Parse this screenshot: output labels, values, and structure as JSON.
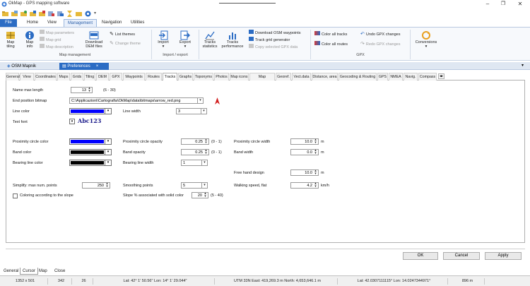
{
  "app": {
    "title": "OkMap - GPS mapping software"
  },
  "ribbon_tabs": [
    "File",
    "Home",
    "View",
    "Management",
    "Navigation",
    "Utilities"
  ],
  "ribbon": {
    "map_tiling": "Map tiling",
    "map_info": "Map info",
    "map_parameters": "Map parameters",
    "map_grid": "Map grid",
    "map_description": "Map description",
    "download_dem": "Download DEM files",
    "list_themes": "List themes",
    "change_theme": "Change theme",
    "map_management": "Map management",
    "import": "Import",
    "export": "Export",
    "import_export": "Import / export",
    "tracks_statistics": "Tracks statistics",
    "tracks_performance": "Tracks performance",
    "download_osm": "Download OSM waypoints",
    "track_grid": "Track grid generator",
    "copy_gpx": "Copy selected GPX data",
    "color_all_tracks": "Color all tracks",
    "color_all_routes": "Color all routes",
    "undo_gpx": "Undo GPX changes",
    "redo_gpx": "Redo GPX changes",
    "gpx": "GPX",
    "conversions": "Conversions"
  },
  "doc_tabs": {
    "map": "OSM Mapnik",
    "prefs": "Preferences",
    "close": "×"
  },
  "sub_tabs": [
    "General",
    "View",
    "Coordinates",
    "Maps",
    "Grids",
    "Tiling",
    "DEM",
    "GPX",
    "Waypoints",
    "Routes",
    "Tracks",
    "Graphs",
    "Toponyms",
    "Photos",
    "Map icons",
    "Map comments",
    "Georef.",
    "Vect.data",
    "Distance, area",
    "Geocoding & Routing",
    "GPS",
    "NMEA",
    "Navig.",
    "Compass"
  ],
  "form": {
    "name_max_length": {
      "label": "Name max length",
      "value": "13",
      "hint": "(6 - 30)"
    },
    "end_position_bitmap": {
      "label": "End position bitmap",
      "value": "C:\\Applicazioni\\Cartografia\\OkMap\\data\\bitmaps\\arrow_red.png"
    },
    "line_color": {
      "label": "Line color"
    },
    "line_width": {
      "label": "Line width",
      "value": "3"
    },
    "text_font": {
      "label": "Text font",
      "sample": "Abc123"
    },
    "proximity_circle_color": {
      "label": "Proximity circle color"
    },
    "proximity_circle_opacity": {
      "label": "Proximity circle opacity",
      "value": "0.25",
      "hint": "(0 - 1)"
    },
    "proximity_circle_width": {
      "label": "Proximity circle width",
      "value": "10.0",
      "unit": "m"
    },
    "band_color": {
      "label": "Band color"
    },
    "band_opacity": {
      "label": "Band opacity",
      "value": "0.25",
      "hint": "(0 - 1)"
    },
    "band_width": {
      "label": "Band width",
      "value": "0.0",
      "unit": "m"
    },
    "bearing_line_color": {
      "label": "Bearing line color"
    },
    "bearing_line_width": {
      "label": "Bearing line width",
      "value": "1"
    },
    "free_hand_design": {
      "label": "Free hand design",
      "value": "10.0",
      "unit": "m"
    },
    "simplify": {
      "label": "Simplify: max num. points",
      "value": "250"
    },
    "smoothing_points": {
      "label": "Smoothing points",
      "value": "5"
    },
    "walking_speed": {
      "label": "Walking speed, flat",
      "value": "4.2",
      "unit": "km/h"
    },
    "coloring_slope": {
      "label": "Coloring according to the slope"
    },
    "slope_solid": {
      "label": "Slope % associated with solid color",
      "value": "20",
      "hint": "(5 - 40)"
    }
  },
  "buttons": {
    "ok": "OK",
    "cancel": "Cancel",
    "apply": "Apply"
  },
  "bottom_tabs": [
    "General",
    "Cursor",
    "Map",
    "Close"
  ],
  "status": {
    "size": "1352 x 501",
    "v1": "342",
    "v2": "26",
    "latlon": "Lat: 42° 1' 50.56\"  Lon: 14° 1' 29.044\"",
    "utm": "UTM 33N  East: 419,269.3  m  North: 4,653,646.1  m",
    "decimal": "Lat: 42.0307111115°  Lon: 14.0247344971°",
    "alt": "896 m"
  },
  "colors": {
    "accent": "#2b6cc4",
    "line_color": "#0000ff",
    "proximity_circle_color": "#0000ff",
    "band_color": "#000000",
    "bearing_line_color": "#000000",
    "font_sample": "#1a1a8a",
    "arrow": "#d21e1e"
  }
}
